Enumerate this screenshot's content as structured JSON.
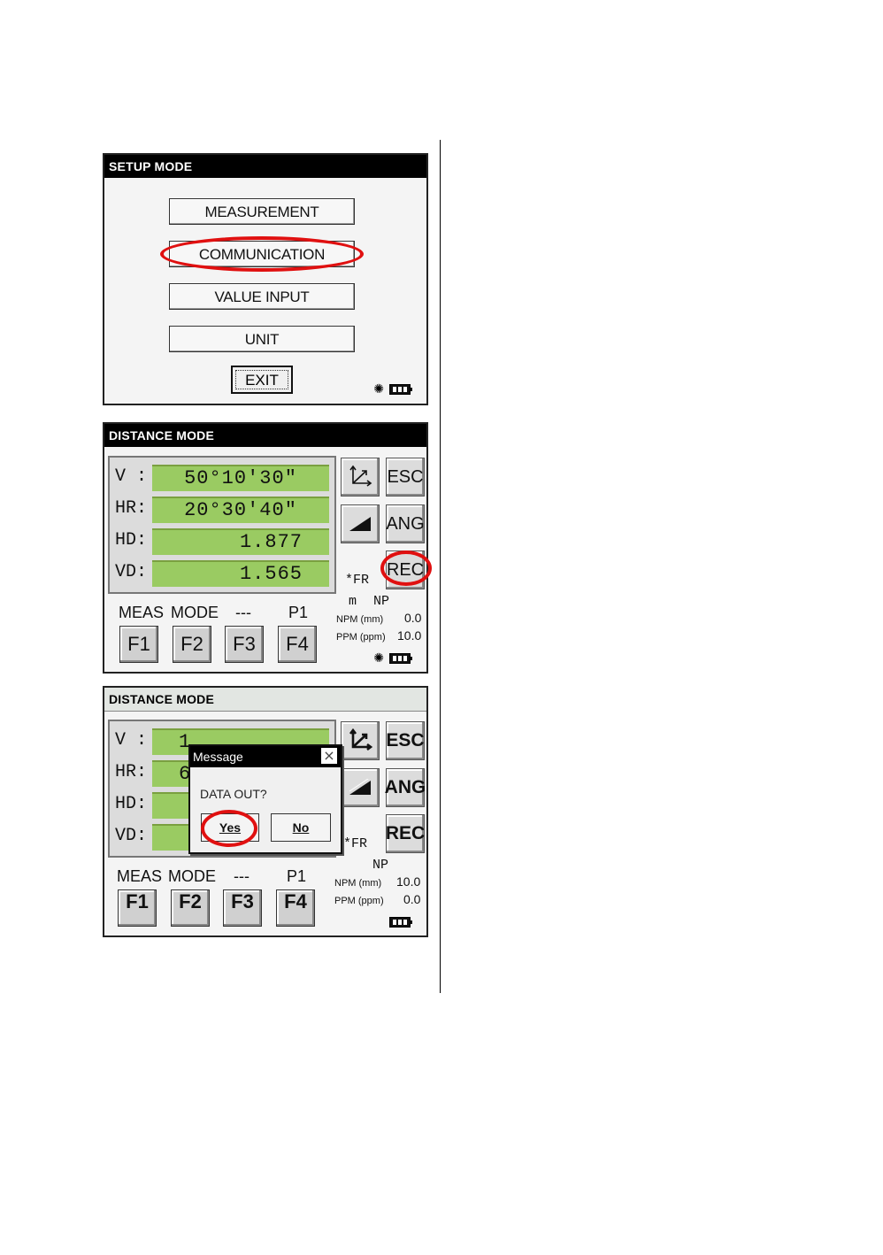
{
  "setup_screen": {
    "title": "SETUP MODE",
    "menu": [
      "MEASUREMENT",
      "COMMUNICATION",
      "VALUE INPUT",
      "UNIT"
    ],
    "exit_label": "EXIT",
    "highlighted_item": "COMMUNICATION"
  },
  "distance_screen_1": {
    "title": "DISTANCE MODE",
    "rows": [
      {
        "label": "V :",
        "value": "50°10'30\""
      },
      {
        "label": "HR:",
        "value": "20°30'40\""
      },
      {
        "label": "HD:",
        "value": "1.877"
      },
      {
        "label": "VD:",
        "value": "1.565"
      }
    ],
    "buttons": {
      "esc": "ESC",
      "ang": "ANG",
      "rec": "REC"
    },
    "fkey_labels": [
      "MEAS",
      "MODE",
      "---",
      "P1"
    ],
    "fkeys": [
      "F1",
      "F2",
      "F3",
      "F4"
    ],
    "fr": "*FR",
    "unit": "m",
    "np": "NP",
    "npm_label": "NPM (mm)",
    "npm_value": "0.0",
    "ppm_label": "PPM (ppm)",
    "ppm_value": "10.0",
    "highlighted_item": "REC"
  },
  "distance_screen_2": {
    "title": "DISTANCE MODE",
    "rows": [
      {
        "label": "V :",
        "value": "1"
      },
      {
        "label": "HR:",
        "value": "6"
      },
      {
        "label": "HD:",
        "value": ""
      },
      {
        "label": "VD:",
        "value": ""
      }
    ],
    "buttons": {
      "esc": "ESC",
      "ang": "ANG",
      "rec": "REC"
    },
    "fkey_labels": [
      "MEAS",
      "MODE",
      "---",
      "P1"
    ],
    "fkeys": [
      "F1",
      "F2",
      "F3",
      "F4"
    ],
    "fr": "*FR",
    "np": "NP",
    "npm_label": "NPM (mm)",
    "npm_value": "10.0",
    "ppm_label": "PPM (ppm)",
    "ppm_value": "0.0",
    "dialog": {
      "title": "Message",
      "close": "×",
      "message": "DATA OUT?",
      "yes": "Yes",
      "no": "No"
    },
    "highlighted_item": "Yes"
  },
  "highlight_color": "#e01010",
  "display_color": "#9acb62",
  "icons": [
    "coordinate-axes-icon",
    "slope-icon",
    "laser-icon",
    "battery-icon",
    "close-icon"
  ]
}
